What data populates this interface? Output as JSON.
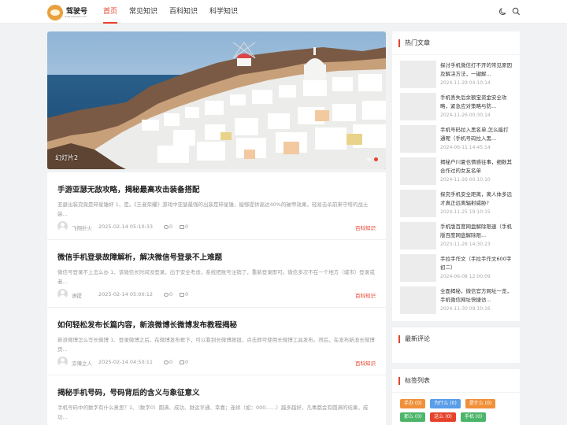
{
  "header": {
    "logo_text": "驾驶号",
    "logo_subtext": "www.example.com",
    "nav": [
      "首页",
      "常见知识",
      "百科知识",
      "科学知识"
    ],
    "icons": [
      "moon-icon",
      "search-icon"
    ]
  },
  "banner": {
    "caption": "幻灯片2",
    "active_slide": 1,
    "slide_count": 2
  },
  "articles": [
    {
      "title": "手游亚瑟无敌攻略，揭秘最高攻击装备搭配",
      "excerpt": "亚瑟出装究竟是碎星锤好 1、是。《王者荣耀》游戏中亚瑟最强的出装是碎星锤，能够提供高达40%的破甲效果，轻易击杀前来守塔的战士装...",
      "author": "飞翔扑火",
      "date": "2025-02-14 05:10:33",
      "views": "0",
      "comments": "0",
      "category": "百科知识"
    },
    {
      "title": "微信手机登录故障解析，解决微信号登录不上难题",
      "excerpt": "微信号登录不上怎么办 1、该微信长时间没登录，出于安全考虑，系统把账号注销了，重新登录即可。微信多次不在一个地方（城市）登录或者...",
      "author": "语提",
      "date": "2025-02-14 05:00:12",
      "views": "0",
      "comments": "0",
      "category": "百科知识"
    },
    {
      "title": "如何轻松发布长篇内容，新浪微博长微博发布教程揭秘",
      "excerpt": "新浪微博怎么写长微博 1、登录微博之后，在微博发布框下，可以看到长微博按钮，点击即可使用长微博工具发布。然后，在发布新浪长微博页...",
      "author": "凉薄之人",
      "date": "2025-02-14 04:50:11",
      "views": "0",
      "comments": "0",
      "category": "百科知识"
    },
    {
      "title": "揭秘手机号码，号码背后的含义与象征意义",
      "excerpt": "手机号码中的数字有什么意思？1、（数字0）圆满、成功、财运亨通、幸喜；连续（如：000……）越多越好，凡事都会有圆满的结果，成功...",
      "author": "",
      "date": "",
      "views": "",
      "comments": "",
      "category": ""
    }
  ],
  "sidebar": {
    "hot_title": "热门文章",
    "hot_items": [
      {
        "title": "探讨手机微信打不开的常见原因及解决方法，一键解...",
        "date": "2024-11-29 04:10:14"
      },
      {
        "title": "手机丢失后余额宝资金安全攻略，紧急应对策略与防...",
        "date": "2024-11-26 00:30:14"
      },
      {
        "title": "手机号码拉入黑名单,怎么能打通呢（手机号码拉入黑...",
        "date": "2024-06-11 14:45:14"
      },
      {
        "title": "揭秘户川夏也情感往事，细数其合作过的女友名单",
        "date": "2024-11-26 00:10:10"
      },
      {
        "title": "探究手机安全距离，离人体多远才真正远离辐射威胁?",
        "date": "2024-11-25 19:10:15"
      },
      {
        "title": "手机版百度网盘解除限速（手机版百度网盘解除限...",
        "date": "2023-11-26 14:30:23"
      },
      {
        "title": "手拉手作文（手拉手作文600字初二）",
        "date": "2024-06-08 12:00:09"
      },
      {
        "title": "全面揭秘，微信官方网址一览，手机微信网址快捷访...",
        "date": "2024-11-30 09:10:16"
      }
    ],
    "comments_title": "最新评论",
    "tags_title": "标签列表",
    "tags": [
      {
        "label": "手办 (0)",
        "color": "#f0913a"
      },
      {
        "label": "为什么 (0)",
        "color": "#5a9de8"
      },
      {
        "label": "是什么 (0)",
        "color": "#f0913a"
      },
      {
        "label": "那么 (0)",
        "color": "#4cb56a"
      },
      {
        "label": "这么 (0)",
        "color": "#e5432a"
      },
      {
        "label": "手机 (0)",
        "color": "#4cb56a"
      }
    ]
  },
  "colors": {
    "accent": "#e5432a"
  }
}
